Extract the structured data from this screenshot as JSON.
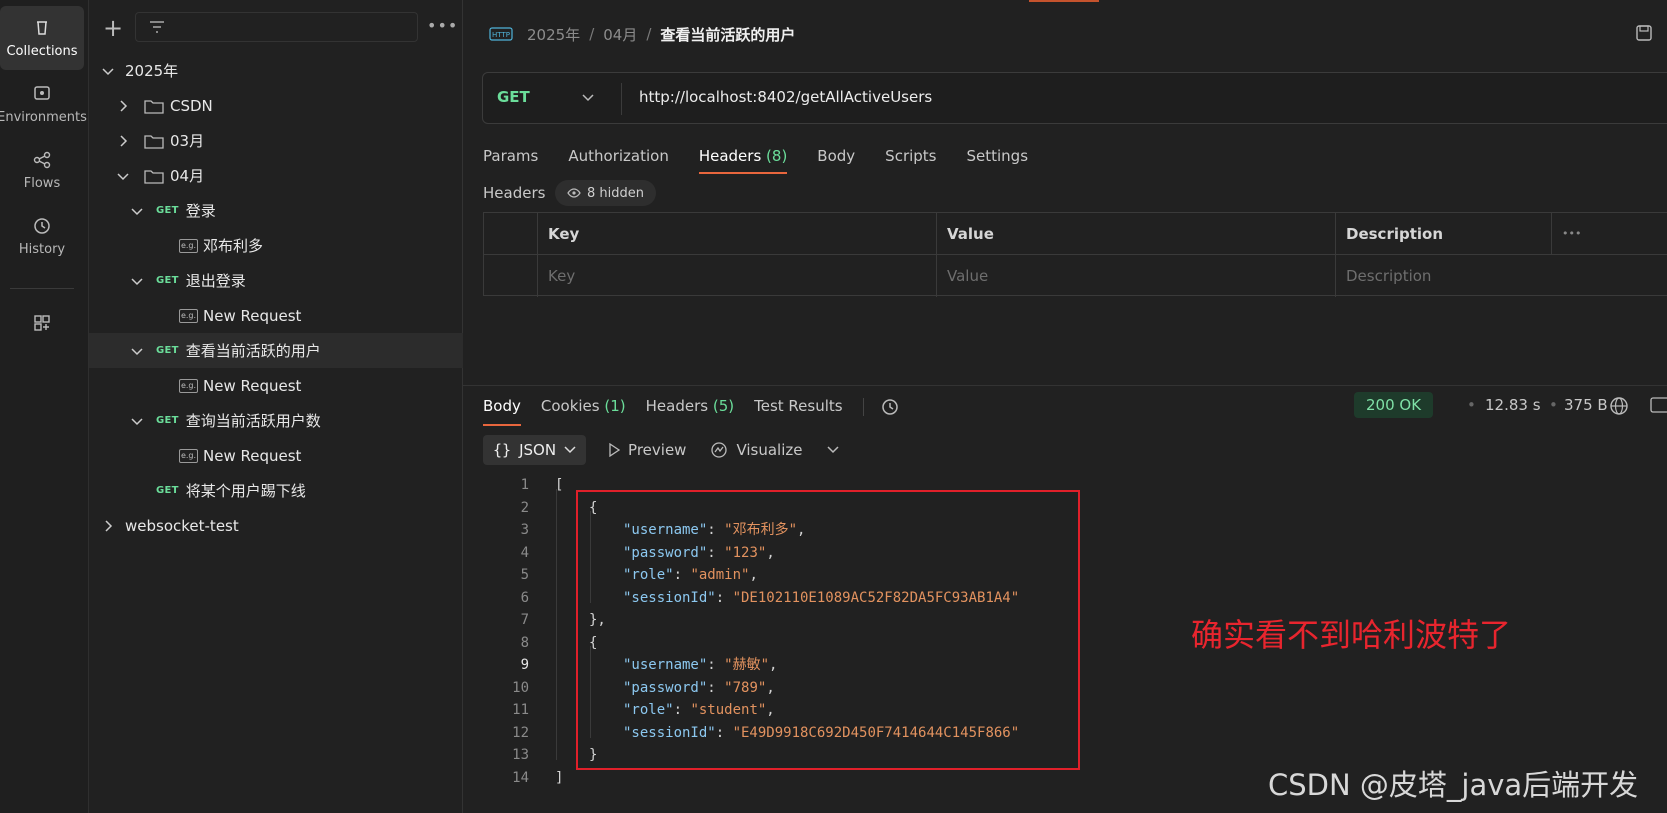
{
  "rail": {
    "items": [
      {
        "label": "Collections",
        "icon": "collections-icon"
      },
      {
        "label": "Environments",
        "icon": "environments-icon"
      },
      {
        "label": "Flows",
        "icon": "flows-icon"
      },
      {
        "label": "History",
        "icon": "history-icon"
      }
    ],
    "extra_icon": "add-workspace-icon"
  },
  "sidebar": {
    "tree": [
      {
        "type": "collection",
        "label": "2025年",
        "expanded": true
      },
      {
        "type": "folder",
        "label": "CSDN",
        "expanded": false
      },
      {
        "type": "folder",
        "label": "03月",
        "expanded": false
      },
      {
        "type": "folder",
        "label": "04月",
        "expanded": true
      },
      {
        "type": "request",
        "method": "GET",
        "label": "登录",
        "expanded": true
      },
      {
        "type": "example",
        "badge": "e.g.",
        "label": "邓布利多"
      },
      {
        "type": "request",
        "method": "GET",
        "label": "退出登录",
        "expanded": true
      },
      {
        "type": "example",
        "badge": "e.g.",
        "label": "New Request"
      },
      {
        "type": "request",
        "method": "GET",
        "label": "查看当前活跃的用户",
        "expanded": true,
        "selected": true
      },
      {
        "type": "example",
        "badge": "e.g.",
        "label": "New Request"
      },
      {
        "type": "request",
        "method": "GET",
        "label": "查询当前活跃用户数",
        "expanded": true
      },
      {
        "type": "example",
        "badge": "e.g.",
        "label": "New Request"
      },
      {
        "type": "request",
        "method": "GET",
        "label": "将某个用户踢下线",
        "expanded": false
      },
      {
        "type": "collection",
        "label": "websocket-test",
        "expanded": false
      }
    ]
  },
  "breadcrumb": {
    "parts": [
      "2025年",
      "04月"
    ],
    "current": "查看当前活跃的用户",
    "sep": "/"
  },
  "request": {
    "method": "GET",
    "url": "http://localhost:8402/getAllActiveUsers",
    "tabs": [
      {
        "label": "Params"
      },
      {
        "label": "Authorization"
      },
      {
        "label": "Headers",
        "count": "(8)",
        "active": true
      },
      {
        "label": "Body"
      },
      {
        "label": "Scripts"
      },
      {
        "label": "Settings"
      }
    ],
    "headers_title": "Headers",
    "hidden_label": "8 hidden",
    "table": {
      "columns": [
        "Key",
        "Value",
        "Description"
      ],
      "placeholders": [
        "Key",
        "Value",
        "Description"
      ],
      "more": "•••"
    }
  },
  "response": {
    "tabs": [
      {
        "label": "Body",
        "active": true
      },
      {
        "label": "Cookies",
        "count": "(1)"
      },
      {
        "label": "Headers",
        "count": "(5)"
      },
      {
        "label": "Test Results"
      }
    ],
    "status": "200 OK",
    "time": "12.83 s",
    "size": "375 B",
    "format": "JSON",
    "preview": "Preview",
    "visualize": "Visualize",
    "code": [
      {
        "n": "1",
        "text": "["
      },
      {
        "n": "2",
        "text": "{"
      },
      {
        "n": "3",
        "key": "\"username\"",
        "val": "\"邓布利多\"",
        "tail": ","
      },
      {
        "n": "4",
        "key": "\"password\"",
        "val": "\"123\"",
        "tail": ","
      },
      {
        "n": "5",
        "key": "\"role\"",
        "val": "\"admin\"",
        "tail": ","
      },
      {
        "n": "6",
        "key": "\"sessionId\"",
        "val": "\"DE102110E1089AC52F82DA5FC93AB1A4\"",
        "tail": ""
      },
      {
        "n": "7",
        "text": "},"
      },
      {
        "n": "8",
        "text": "{"
      },
      {
        "n": "9",
        "key": "\"username\"",
        "val": "\"赫敏\"",
        "tail": ","
      },
      {
        "n": "10",
        "key": "\"password\"",
        "val": "\"789\"",
        "tail": ","
      },
      {
        "n": "11",
        "key": "\"role\"",
        "val": "\"student\"",
        "tail": ","
      },
      {
        "n": "12",
        "key": "\"sessionId\"",
        "val": "\"E49D9918C692D450F7414644C145F866\"",
        "tail": ""
      },
      {
        "n": "13",
        "text": "}"
      },
      {
        "n": "14",
        "text": "]"
      }
    ]
  },
  "annotation": "确实看不到哈利波特了",
  "watermark": "CSDN @皮塔_java后端开发",
  "colors": {
    "accent": "#e8663d",
    "get_method": "#6bdd9a",
    "annotation_red": "#e0202a",
    "status_ok": "#7fe0a6"
  }
}
